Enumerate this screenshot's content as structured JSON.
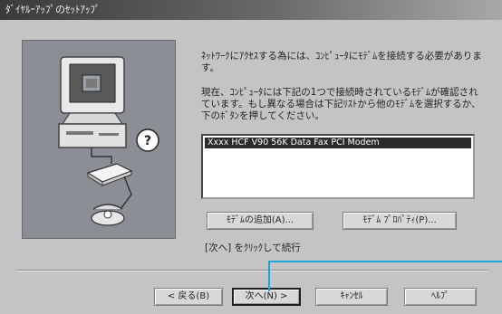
{
  "window": {
    "title": "ﾀﾞｲﾔﾙｰｱｯﾌﾟのｾｯﾄｱｯﾌﾟ"
  },
  "content": {
    "intro_text": "ﾈｯﾄﾜｰｸにｱｸｾｽする為には、ｺﾝﾋﾟｭｰﾀにﾓﾃﾞﾑを接続する必要があります。",
    "status_text": "現在、ｺﾝﾋﾟｭｰﾀには下記の1つで接続時されているﾓﾃﾞﾑが確認されています。もし異なる場合は下記ﾘｽﾄから他のﾓﾃﾞﾑを選択するか、下のﾎﾞﾀﾝを押してください。",
    "modem_list": {
      "selected_item": "Xxxx HCF V90 56K Data Fax PCI Modem"
    },
    "add_modem_label": "ﾓﾃﾞﾑの追加(A)...",
    "modem_properties_label": "ﾓﾃﾞﾑ ﾌﾟﾛﾊﾟﾃｨ(P)...",
    "hint_text": "[次へ] をｸﾘｯｸして続行"
  },
  "buttons": {
    "back": "< 戻る(B)",
    "next": "次へ(N) >",
    "cancel": "ｷｬﾝｾﾙ",
    "help": "ﾍﾙﾌﾟ"
  },
  "colors": {
    "annotation_line": "#1aa6d6",
    "list_selection": "#2a2a2a"
  },
  "icons": {
    "illustration": "computer-with-modem-and-telephone"
  }
}
